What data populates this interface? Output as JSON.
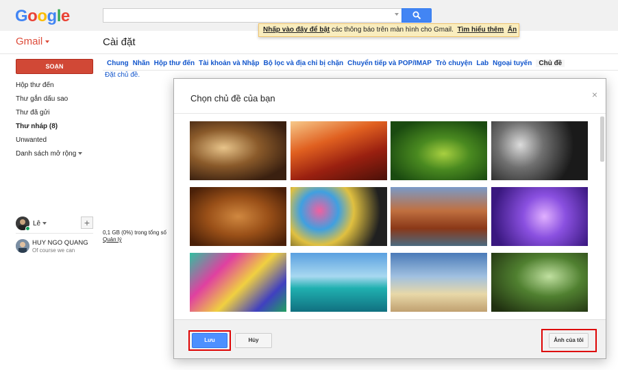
{
  "header": {
    "logo_letters": [
      "G",
      "o",
      "o",
      "g",
      "l",
      "e"
    ],
    "logo_colors": [
      "#4285f4",
      "#ea4335",
      "#fbbc05",
      "#4285f4",
      "#34a853",
      "#ea4335"
    ],
    "search_value": "",
    "notice_link1": "Nhấp vào đây để bật",
    "notice_text": " các thông báo trên màn hình cho Gmail.",
    "notice_link2": "Tìm hiểu thêm",
    "notice_hide": "Ẩn"
  },
  "app": {
    "gmail_label": "Gmail",
    "page_title": "Cài đặt"
  },
  "sidebar": {
    "compose_label": "SOẠN",
    "items": [
      {
        "label": "Hộp thư đến",
        "bold": false
      },
      {
        "label": "Thư gắn dấu sao",
        "bold": false
      },
      {
        "label": "Thư đã gửi",
        "bold": false
      },
      {
        "label": "Thư nháp (8)",
        "bold": true
      },
      {
        "label": "Unwanted",
        "bold": false
      },
      {
        "label": "Danh sách mở rộng",
        "bold": false
      }
    ],
    "user_name": "Lê",
    "contact_name": "HUY NGO QUANG",
    "contact_status": "Of course we can"
  },
  "settings": {
    "tabs": [
      "Chung",
      "Nhãn",
      "Hộp thư đến",
      "Tài khoản và Nhập",
      "Bộ lọc và địa chỉ bị chặn",
      "Chuyển tiếp và POP/IMAP",
      "Trò chuyện",
      "Lab",
      "Ngoại tuyến",
      "Chủ đề"
    ],
    "active_tab_index": 9,
    "sub_link": "Đặt chủ đề.",
    "storage_text": "0,1 GB (0%) trong tổng số",
    "manage_link": "Quản lý"
  },
  "modal": {
    "title": "Chọn chủ đề của bạn",
    "close_symbol": "×",
    "save_label": "Lưu",
    "cancel_label": "Hủy",
    "my_photos_label": "Ảnh của tôi",
    "themes": [
      "chess-pieces",
      "red-canyon",
      "green-caterpillar",
      "metal-pipes",
      "autumn-leaves",
      "colorful-bokeh",
      "river-canyon",
      "purple-jellyfish",
      "rainbow-swirl",
      "tropical-lagoon",
      "beach-person",
      "forest-stream",
      "dark-theme-1",
      "dark-theme-2",
      "dark-theme-3",
      "dark-theme-4"
    ]
  }
}
